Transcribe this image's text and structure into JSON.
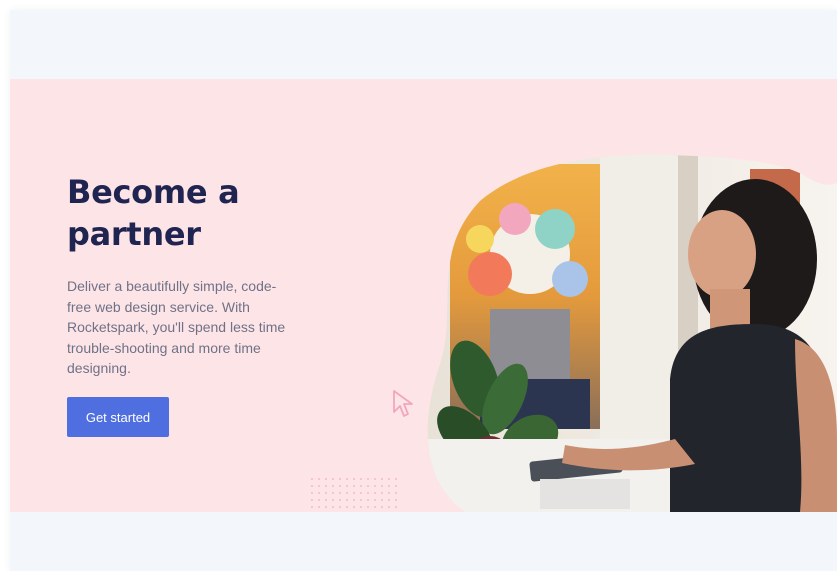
{
  "hero": {
    "title": "Become a partner",
    "description": "Deliver a beautifully simple, code-free web design service. With Rocketspark, you'll spend less time trouble-shooting and more time designing.",
    "cta_label": "Get started"
  },
  "colors": {
    "page_background": "#f3f7fb",
    "hero_background": "#fde4e7",
    "title": "#1f2450",
    "body_text": "#6f7287",
    "button": "#4f6fe0",
    "cursor_outline": "#f2a6bd"
  },
  "icons": [
    "cursor-arrow-icon",
    "dot-grid-decoration"
  ]
}
